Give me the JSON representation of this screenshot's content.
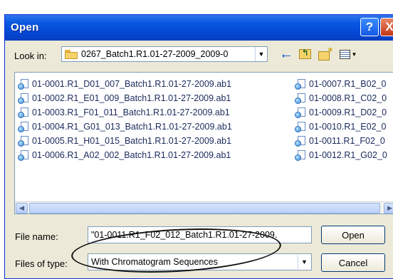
{
  "window": {
    "title": "Open"
  },
  "title_buttons": {
    "help": "?",
    "close": "X"
  },
  "toolbar": {
    "look_in_label": "Look in:",
    "look_in_value": "0267_Batch1.R1.01-27-2009_2009-0",
    "back_icon": "back-arrow-icon",
    "up_icon": "up-one-level-icon",
    "new_folder_icon": "new-folder-icon",
    "view_icon": "view-menu-icon"
  },
  "files": {
    "column1": [
      "01-0001.R1_D01_007_Batch1.R1.01-27-2009.ab1",
      "01-0002.R1_E01_009_Batch1.R1.01-27-2009.ab1",
      "01-0003.R1_F01_011_Batch1.R1.01-27-2009.ab1",
      "01-0004.R1_G01_013_Batch1.R1.01-27-2009.ab1",
      "01-0005.R1_H01_015_Batch1.R1.01-27-2009.ab1",
      "01-0006.R1_A02_002_Batch1.R1.01-27-2009.ab1"
    ],
    "column2": [
      "01-0007.R1_B02_0",
      "01-0008.R1_C02_0",
      "01-0009.R1_D02_0",
      "01-0010.R1_E02_0",
      "01-0011.R1_F02_0",
      "01-0012.R1_G02_0"
    ]
  },
  "fields": {
    "file_name_label": "File name:",
    "file_name_value": "\"01-0011.R1_F02_012_Batch1.R1.01-27-2009.",
    "files_of_type_label": "Files of type:",
    "files_of_type_value": "With Chromatogram Sequences"
  },
  "buttons": {
    "open": "Open",
    "cancel": "Cancel"
  },
  "colors": {
    "titlebar": "#0a58e0",
    "dialog_bg": "#ece9d8",
    "annotation": "#111111"
  }
}
